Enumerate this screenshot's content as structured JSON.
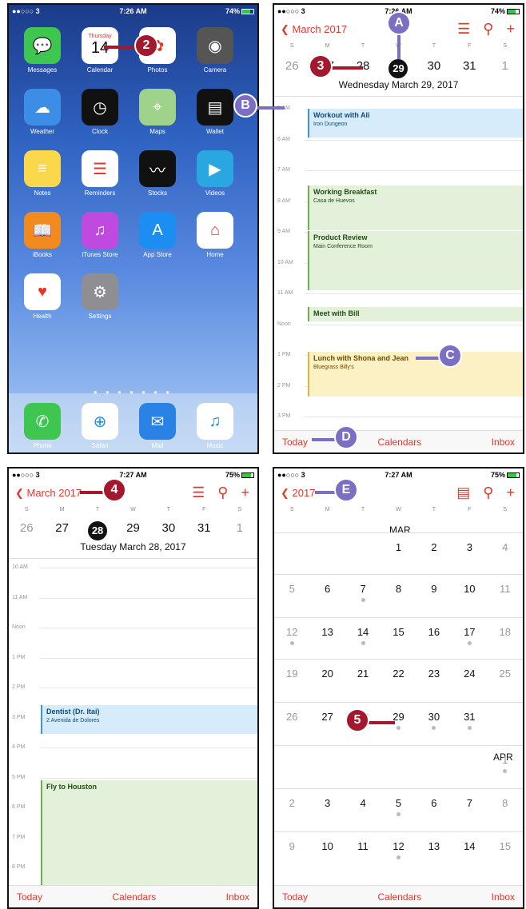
{
  "status": {
    "carrier": "●●○○○ 3",
    "p1_time": "7:26 AM",
    "p1_battery": "74%",
    "p2_time": "7:26 AM",
    "p2_battery": "74%",
    "p3_time": "7:27 AM",
    "p3_battery": "75%",
    "p4_time": "7:27 AM",
    "p4_battery": "75%"
  },
  "home": {
    "apps": [
      {
        "label": "Messages",
        "icon": "messages-icon",
        "color": "#3fc650",
        "glyph": "💬"
      },
      {
        "label": "Calendar",
        "icon": "calendar-icon",
        "color": "#ffffff",
        "glyph": ""
      },
      {
        "label": "Photos",
        "icon": "photos-icon",
        "color": "#ffffff",
        "glyph": "✿"
      },
      {
        "label": "Camera",
        "icon": "camera-icon",
        "color": "#555555",
        "glyph": "◉"
      },
      {
        "label": "Weather",
        "icon": "weather-icon",
        "color": "#3c8de6",
        "glyph": "☁"
      },
      {
        "label": "Clock",
        "icon": "clock-icon",
        "color": "#111111",
        "glyph": "◷"
      },
      {
        "label": "Maps",
        "icon": "maps-icon",
        "color": "#9fd28a",
        "glyph": "⌖"
      },
      {
        "label": "Wallet",
        "icon": "wallet-icon",
        "color": "#111111",
        "glyph": "▤"
      },
      {
        "label": "Notes",
        "icon": "notes-icon",
        "color": "#fbd74b",
        "glyph": "≡"
      },
      {
        "label": "Reminders",
        "icon": "reminders-icon",
        "color": "#ffffff",
        "glyph": "☰"
      },
      {
        "label": "Stocks",
        "icon": "stocks-icon",
        "color": "#111111",
        "glyph": "〰"
      },
      {
        "label": "Videos",
        "icon": "videos-icon",
        "color": "#2aa7e0",
        "glyph": "▶"
      },
      {
        "label": "iBooks",
        "icon": "ibooks-icon",
        "color": "#f28b1f",
        "glyph": "📖"
      },
      {
        "label": "iTunes Store",
        "icon": "itunes-icon",
        "color": "#c04ae0",
        "glyph": "♫"
      },
      {
        "label": "App Store",
        "icon": "appstore-icon",
        "color": "#1c8ef2",
        "glyph": "A"
      },
      {
        "label": "Home",
        "icon": "home-icon",
        "color": "#ffffff",
        "glyph": "⌂"
      },
      {
        "label": "Health",
        "icon": "health-icon",
        "color": "#ffffff",
        "glyph": "♥"
      },
      {
        "label": "Settings",
        "icon": "settings-icon",
        "color": "#8e8e93",
        "glyph": "⚙"
      }
    ],
    "calendar_icon_day": "Thursday",
    "calendar_icon_date": "14",
    "dock": [
      {
        "label": "Phone",
        "icon": "phone-icon",
        "color": "#3fc650",
        "glyph": "✆"
      },
      {
        "label": "Safari",
        "icon": "safari-icon",
        "color": "#ffffff",
        "glyph": "⊕"
      },
      {
        "label": "Mail",
        "icon": "mail-icon",
        "color": "#2a82e6",
        "glyph": "✉"
      },
      {
        "label": "Music",
        "icon": "music-icon",
        "color": "#ffffff",
        "glyph": "♫"
      }
    ]
  },
  "day_view_1": {
    "back": "March 2017",
    "dow": [
      "S",
      "M",
      "T",
      "W",
      "T",
      "F",
      "S"
    ],
    "dates": [
      "26",
      "27",
      "28",
      "29",
      "30",
      "31",
      "1"
    ],
    "subtitle": "Wednesday  March 29, 2017",
    "hours": [
      "5 AM",
      "6 AM",
      "7 AM",
      "8 AM",
      "9 AM",
      "10 AM",
      "11 AM",
      "Noon",
      "1 PM",
      "2 PM",
      "3 PM"
    ],
    "events": [
      {
        "title": "Workout with Ali",
        "place": "Iron Dungeon"
      },
      {
        "title": "Working Breakfast",
        "place": "Casa de Huevos"
      },
      {
        "title": "Product Review",
        "place": "Main Conference Room"
      },
      {
        "title": "Meet with Bill",
        "place": ""
      },
      {
        "title": "Lunch with Shona and Jean",
        "place": "Bluegrass Billy's"
      }
    ]
  },
  "day_view_2": {
    "back": "March 2017",
    "dow": [
      "S",
      "M",
      "T",
      "W",
      "T",
      "F",
      "S"
    ],
    "dates": [
      "26",
      "27",
      "28",
      "29",
      "30",
      "31",
      "1"
    ],
    "subtitle": "Tuesday  March 28, 2017",
    "hours": [
      "10 AM",
      "11 AM",
      "Noon",
      "1 PM",
      "2 PM",
      "3 PM",
      "4 PM",
      "5 PM",
      "6 PM",
      "7 PM",
      "8 PM"
    ],
    "events": [
      {
        "title": "Dentist (Dr. Itai)",
        "place": "2 Avenida de Dolores"
      },
      {
        "title": "Fly to Houston",
        "place": ""
      }
    ]
  },
  "month_view": {
    "back": "2017",
    "dow": [
      "S",
      "M",
      "T",
      "W",
      "T",
      "F",
      "S"
    ],
    "mar_label": "MAR",
    "apr_label": "APR",
    "rows": [
      [
        "",
        "",
        "",
        "1",
        "2",
        "3",
        "4"
      ],
      [
        "5",
        "6",
        "7",
        "8",
        "9",
        "10",
        "11"
      ],
      [
        "12",
        "13",
        "14",
        "15",
        "16",
        "17",
        "18"
      ],
      [
        "19",
        "20",
        "21",
        "22",
        "23",
        "24",
        "25"
      ],
      [
        "26",
        "27",
        "28",
        "29",
        "30",
        "31",
        ""
      ],
      [
        "",
        "",
        "",
        "",
        "",
        "",
        "1"
      ],
      [
        "2",
        "3",
        "4",
        "5",
        "6",
        "7",
        "8"
      ],
      [
        "9",
        "10",
        "11",
        "12",
        "13",
        "14",
        "15"
      ]
    ]
  },
  "tabs": {
    "today": "Today",
    "calendars": "Calendars",
    "inbox": "Inbox"
  },
  "callouts": {
    "c2": "2",
    "c3": "3",
    "c4": "4",
    "c5": "5",
    "cA": "A",
    "cB": "B",
    "cC": "C",
    "cD": "D",
    "cE": "E"
  }
}
